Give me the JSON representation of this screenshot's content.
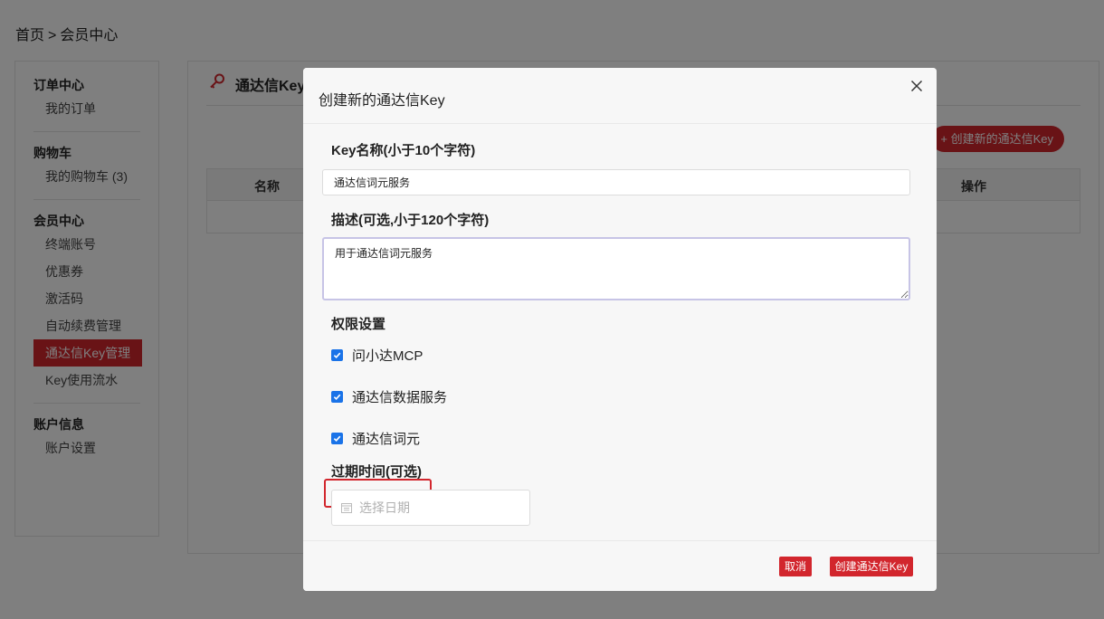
{
  "breadcrumb": {
    "home": "首页",
    "separator": ">",
    "current": "会员中心"
  },
  "sidebar": {
    "groups": [
      {
        "title": "订单中心",
        "items": [
          "我的订单"
        ]
      },
      {
        "title": "购物车",
        "items": [
          "我的购物车 (3)"
        ]
      },
      {
        "title": "会员中心",
        "items": [
          "终端账号",
          "优惠券",
          "激活码",
          "自动续费管理",
          "通达信Key管理",
          "Key使用流水"
        ]
      },
      {
        "title": "账户信息",
        "items": [
          "账户设置"
        ]
      }
    ],
    "active_item": "通达信Key管理"
  },
  "main": {
    "title": "通达信Key",
    "create_button": "+ 创建新的通达信Key",
    "table_headers": {
      "name": "名称",
      "action": "操作"
    }
  },
  "modal": {
    "title": "创建新的通达信Key",
    "name_label": "Key名称(小于10个字符)",
    "name_value": "通达信词元服务",
    "desc_label": "描述(可选,小于120个字符)",
    "desc_value": "用于通达信词元服务",
    "perm_label": "权限设置",
    "permissions": [
      {
        "label": "问小达MCP",
        "checked": true
      },
      {
        "label": "通达信数据服务",
        "checked": true
      },
      {
        "label": "通达信词元",
        "checked": true
      }
    ],
    "expire_label": "过期时间(可选)",
    "date_placeholder": "选择日期",
    "cancel_button": "取消",
    "submit_button": "创建通达信Key"
  },
  "colors": {
    "accent": "#d2262d",
    "checkbox": "#1a73e8"
  }
}
